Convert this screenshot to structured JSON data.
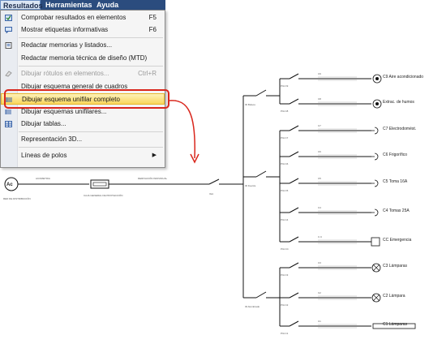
{
  "menubar": {
    "items": [
      "Resultados",
      "Herramientas",
      "Ayuda"
    ]
  },
  "menu": {
    "items": [
      {
        "label": "Comprobar resultados en elementos",
        "shortcut": "F5",
        "icon": "check-icon",
        "disabled": false
      },
      {
        "label": "Mostrar etiquetas informativas",
        "shortcut": "F6",
        "icon": "tag-icon",
        "disabled": false
      },
      {
        "label": "Redactar memorias y listados...",
        "shortcut": "",
        "icon": "document-icon",
        "disabled": false
      },
      {
        "label": "Redactar memoria técnica de diseño (MTD)",
        "shortcut": "",
        "icon": "",
        "disabled": false
      },
      {
        "label": "Dibujar rótulos en elementos...",
        "shortcut": "Ctrl+R",
        "icon": "label-icon",
        "disabled": true
      },
      {
        "label": "Dibujar esquema general de cuadros",
        "shortcut": "",
        "icon": "",
        "disabled": false
      },
      {
        "label": "Dibujar esquema unifilar completo",
        "shortcut": "",
        "icon": "schema-icon",
        "disabled": false
      },
      {
        "label": "Dibujar esquemas unifilares...",
        "shortcut": "",
        "icon": "schema-icon",
        "disabled": false
      },
      {
        "label": "Dibujar tablas...",
        "shortcut": "",
        "icon": "table-icon",
        "disabled": false
      },
      {
        "label": "Representación 3D...",
        "shortcut": "",
        "icon": "",
        "disabled": false
      },
      {
        "label": "Líneas de polos",
        "shortcut": "",
        "icon": "",
        "disabled": false
      }
    ]
  },
  "schematic": {
    "source": "Ac",
    "main_labels": [
      "RED DE DISTRIBUCIÓN",
      "ACOMETIDA",
      "CAJA GENERAL DE PROTECCIÓN",
      "DERIVACIÓN INDIVIDUAL",
      "IGA"
    ],
    "differentials": [
      "ID Bolsos",
      "ID Fuerza",
      "ID Alumbrado"
    ],
    "breakers": [
      "PIA C9",
      "PIA C8",
      "PIA C7",
      "PIA C6",
      "PIA C5",
      "PIA C4",
      "PIA CC",
      "PIA C3",
      "PIA C2",
      "PIA C1"
    ],
    "circuits": [
      "C9",
      "C8",
      "C7",
      "C6",
      "C5",
      "C4",
      "C.C",
      "C3",
      "C2",
      "C1"
    ],
    "loads": [
      "C9 Aire acondicionado",
      "Extrac. de humos",
      "C7 Electrodomést.",
      "C6 Frigorífico",
      "C5 Toma 16A",
      "C4 Tomas 25A",
      "CC Emergencia",
      "C3 Lámparas",
      "C2 Lámpara",
      "C1 Lámparas"
    ]
  }
}
